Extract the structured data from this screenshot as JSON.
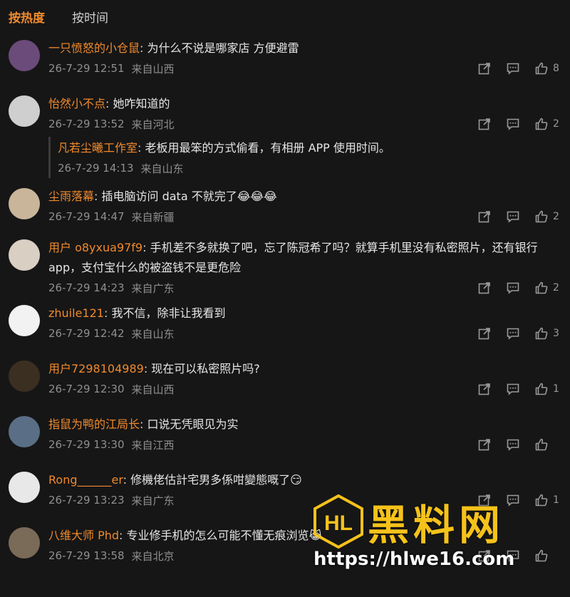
{
  "tabs": [
    {
      "label": "按热度"
    },
    {
      "label": "按时间"
    }
  ],
  "comments": [
    {
      "user": "一只愤怒的小仓鼠",
      "text": "为什么不说是哪家店 方便避雷",
      "time": "26-7-29 12:51",
      "location": "来自山西",
      "likes": "8"
    },
    {
      "user": "怡然小不点",
      "text": "她咋知道的",
      "time": "26-7-29 13:52",
      "location": "来自河北",
      "likes": "2",
      "reply": {
        "user": "凡若尘曦工作室",
        "text": "老板用最笨的方式偷看，有相册 APP 使用时间。",
        "time": "26-7-29 14:13",
        "location": "来自山东"
      }
    },
    {
      "user": "尘雨落幕",
      "text": "插电脑访问 data 不就完了😂😂😂",
      "time": "26-7-29 14:47",
      "location": "来自新疆",
      "likes": "2"
    },
    {
      "user": "用户 o8yxua97f9",
      "text": "手机差不多就换了吧，忘了陈冠希了吗？就算手机里没有私密照片，还有银行app，支付宝什么的被盗钱不是更危险",
      "time": "26-7-29 14:23",
      "location": "来自广东",
      "likes": "2"
    },
    {
      "user": "zhuile121",
      "text": "我不信，除非让我看到",
      "time": "26-7-29 12:42",
      "location": "来自山东",
      "likes": "3"
    },
    {
      "user": "用户7298104989",
      "text": "现在可以私密照片吗?",
      "time": "26-7-29 12:30",
      "location": "来自山西",
      "likes": "1"
    },
    {
      "user": "指鼠为鸭的江局长",
      "text": "口说无凭眼见为实",
      "time": "26-7-29 13:30",
      "location": "来自江西",
      "likes": ""
    },
    {
      "user": "Rong______er",
      "text": "修機佬估計宅男多係咁變態嘅了😏",
      "time": "26-7-29 13:23",
      "location": "来自广东",
      "likes": "1"
    },
    {
      "user": "八维大师 Phd",
      "text": "专业修手机的怎么可能不懂无痕浏览😹",
      "time": "26-7-29 13:58",
      "location": "来自北京",
      "likes": ""
    }
  ],
  "watermark": {
    "title": "黑料网",
    "url": "https://hlwe16.com",
    "logo": "HL"
  },
  "colors": {
    "accent": "#f08a2c",
    "background": "#161616",
    "watermark": "#f6c21a"
  }
}
